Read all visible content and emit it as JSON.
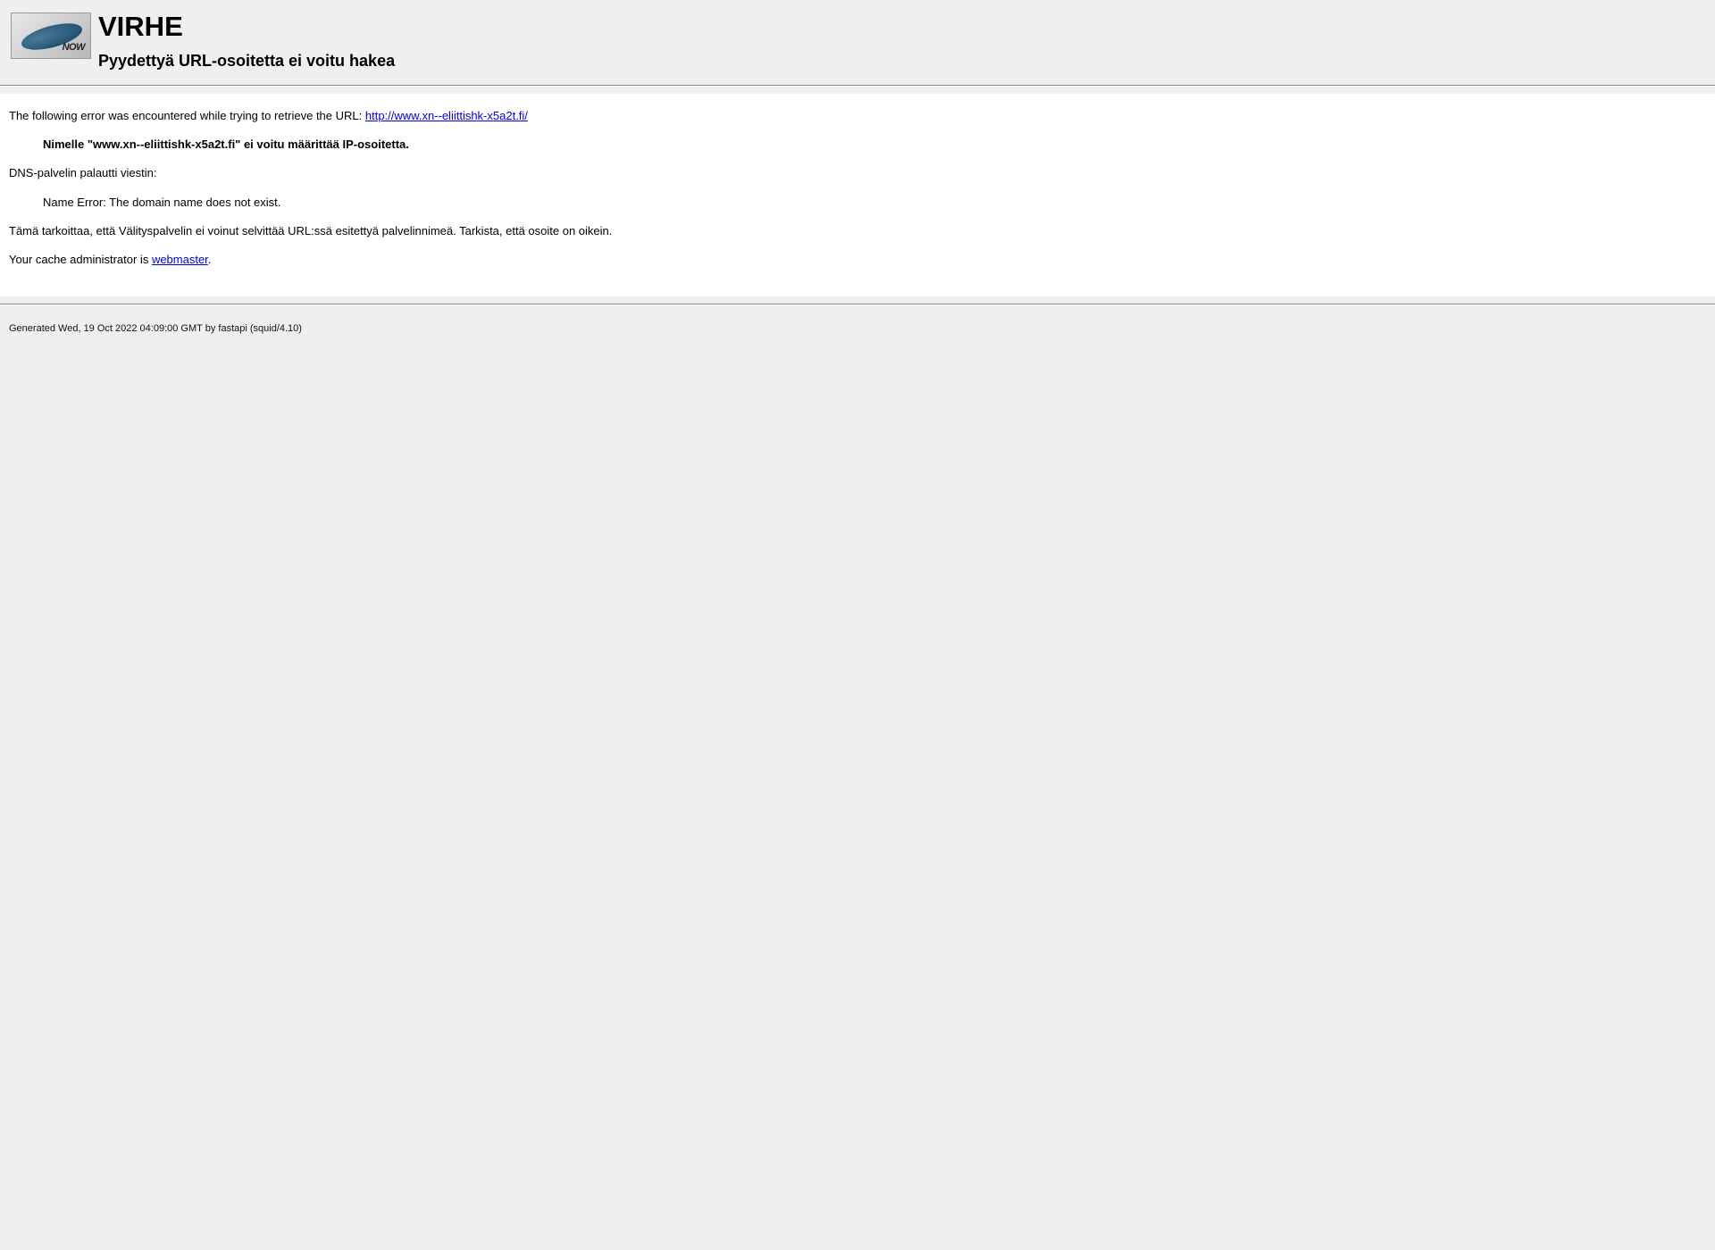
{
  "header": {
    "logo_text": "NOW",
    "title": "VIRHE",
    "subtitle": "Pyydettyä URL-osoitetta ei voitu hakea"
  },
  "content": {
    "intro_prefix": "The following error was encountered while trying to retrieve the URL: ",
    "url": "http://www.xn--eliittishk-x5a2t.fi/",
    "error_bold": "Nimelle \"www.xn--eliittishk-x5a2t.fi\" ei voitu määrittää IP-osoitetta.",
    "dns_line": "DNS-palvelin palautti viestin:",
    "dns_msg": "Name Error: The domain name does not exist.",
    "explanation": "Tämä tarkoittaa, että Välityspalvelin ei voinut selvittää URL:ssä esitettyä palvelinnimeä. Tarkista, että osoite on oikein.",
    "admin_prefix": "Your cache administrator is ",
    "admin_link": "webmaster",
    "admin_suffix": "."
  },
  "footer": {
    "generated": "Generated Wed, 19 Oct 2022 04:09:00 GMT by fastapi (squid/4.10)"
  }
}
